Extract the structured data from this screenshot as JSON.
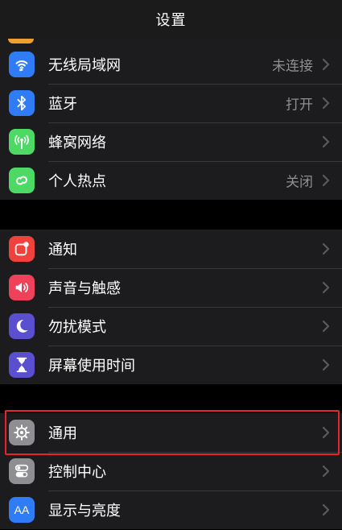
{
  "header": {
    "title": "设置"
  },
  "groups": [
    {
      "items": [
        {
          "label": "无线局域网",
          "value": "未连接",
          "icon": "wifi-icon",
          "icon_color": "#2f7cf6"
        },
        {
          "label": "蓝牙",
          "value": "打开",
          "icon": "bluetooth-icon",
          "icon_color": "#2f7cf6"
        },
        {
          "label": "蜂窝网络",
          "value": "",
          "icon": "cellular-icon",
          "icon_color": "#4cd964"
        },
        {
          "label": "个人热点",
          "value": "关闭",
          "icon": "hotspot-icon",
          "icon_color": "#4cd964"
        }
      ]
    },
    {
      "items": [
        {
          "label": "通知",
          "icon": "notifications-icon",
          "icon_color": "#f0413c"
        },
        {
          "label": "声音与触感",
          "icon": "sound-icon",
          "icon_color": "#f0415a"
        },
        {
          "label": "勿扰模式",
          "icon": "moon-icon",
          "icon_color": "#5a4fcf"
        },
        {
          "label": "屏幕使用时间",
          "icon": "hourglass-icon",
          "icon_color": "#5a4fcf"
        }
      ]
    },
    {
      "items": [
        {
          "label": "通用",
          "icon": "gear-icon",
          "icon_color": "#8e8e93",
          "highlighted": true
        },
        {
          "label": "控制中心",
          "icon": "control-center-icon",
          "icon_color": "#8e8e93"
        },
        {
          "label": "显示与亮度",
          "icon": "display-brightness-icon",
          "icon_color": "#2f7cf6",
          "icon_text": "AA"
        }
      ]
    }
  ],
  "colors": {
    "highlight": "#e8242a",
    "chevron": "#5a5a5e"
  }
}
